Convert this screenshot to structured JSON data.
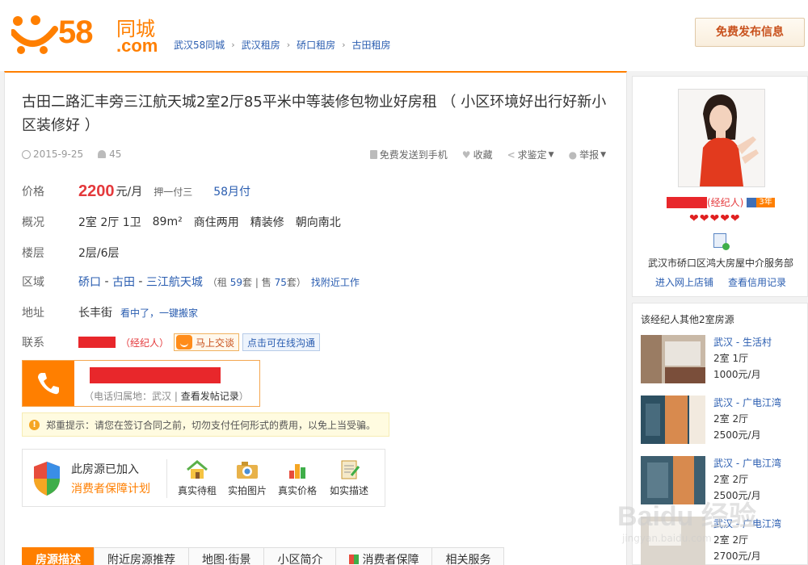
{
  "header": {
    "logo_number": "58",
    "logo_cn": "同城",
    "logo_com": ".com",
    "breadcrumb": [
      "武汉58同城",
      "武汉租房",
      "硚口租房",
      "古田租房"
    ],
    "publish_button": "免费发布信息"
  },
  "listing": {
    "title": "古田二路汇丰旁三江航天城2室2厅85平米中等装修包物业好房租 （ 小区环境好出行好新小区装修好 ）",
    "date": "2015-9-25",
    "views": "45",
    "actions": [
      "免费发送到手机",
      "收藏",
      "求鉴定",
      "举报"
    ],
    "price_label": "价格",
    "price": "2200",
    "price_unit": "元/月",
    "deposit": "押一付三",
    "pay_link": "58月付",
    "overview_label": "概况",
    "overview": [
      "2室 2厅 1卫",
      "89m²",
      "商住两用",
      "精装修",
      "朝向南北"
    ],
    "floor_label": "楼层",
    "floor": "2层/6层",
    "area_label": "区域",
    "area_links": [
      "硚口",
      "古田",
      "三江航天城"
    ],
    "area_sep": " - ",
    "area_counts": {
      "rent_prefix": "（租",
      "rent": "59",
      "rent_suffix": "套 |",
      "sale_prefix": "售",
      "sale": "75",
      "sale_suffix": "套）"
    },
    "job_link": "找附近工作",
    "address_label": "地址",
    "address": "长丰街",
    "move_link": "看中了，一键搬家",
    "contact_label": "联系",
    "contact_role": "（经纪人）",
    "chat_button": "马上交谈",
    "online_tip": "点击可在线沟通",
    "phone_location": "（电话归属地：武汉 | ",
    "phone_records_link": "查看发帖记录",
    "phone_location_end": "）",
    "warning": "郑重提示：请您在签订合同之前，切勿支付任何形式的费用，以免上当受骗。",
    "guarantee_line1": "此房源已加入",
    "guarantee_line2": "消费者保障计划",
    "guarantee_items": [
      "真实待租",
      "实拍图片",
      "真实价格",
      "如实描述"
    ],
    "tabs": [
      "房源描述",
      "附近房源推荐",
      "地图·街景",
      "小区简介",
      "消费者保障",
      "相关服务"
    ]
  },
  "agent": {
    "role": "(经纪人)",
    "years": "3年",
    "hearts": "❤❤❤❤❤",
    "company": "武汉市硚口区鸿大房屋中介服务部",
    "shop_link": "进入网上店铺",
    "credit_link": "查看信用记录",
    "others_title": "该经纪人其他2室房源",
    "others": [
      {
        "location": "武汉 - 生活村",
        "layout": "2室 1厅",
        "price": "1000元/月"
      },
      {
        "location": "武汉 - 广电江湾",
        "layout": "2室 2厅",
        "price": "2500元/月"
      },
      {
        "location": "武汉 - 广电江湾",
        "layout": "2室 2厅",
        "price": "2500元/月"
      },
      {
        "location": "武汉 - 广电江湾",
        "layout": "2室 2厅",
        "price": "2700元/月"
      }
    ]
  },
  "watermark": {
    "text": "Baidu 经验",
    "url_text": "jingyan.baidu.com"
  },
  "colors": {
    "brand_orange": "#ff7f00",
    "price_red": "#e4393c",
    "link_blue": "#2a5db0"
  }
}
